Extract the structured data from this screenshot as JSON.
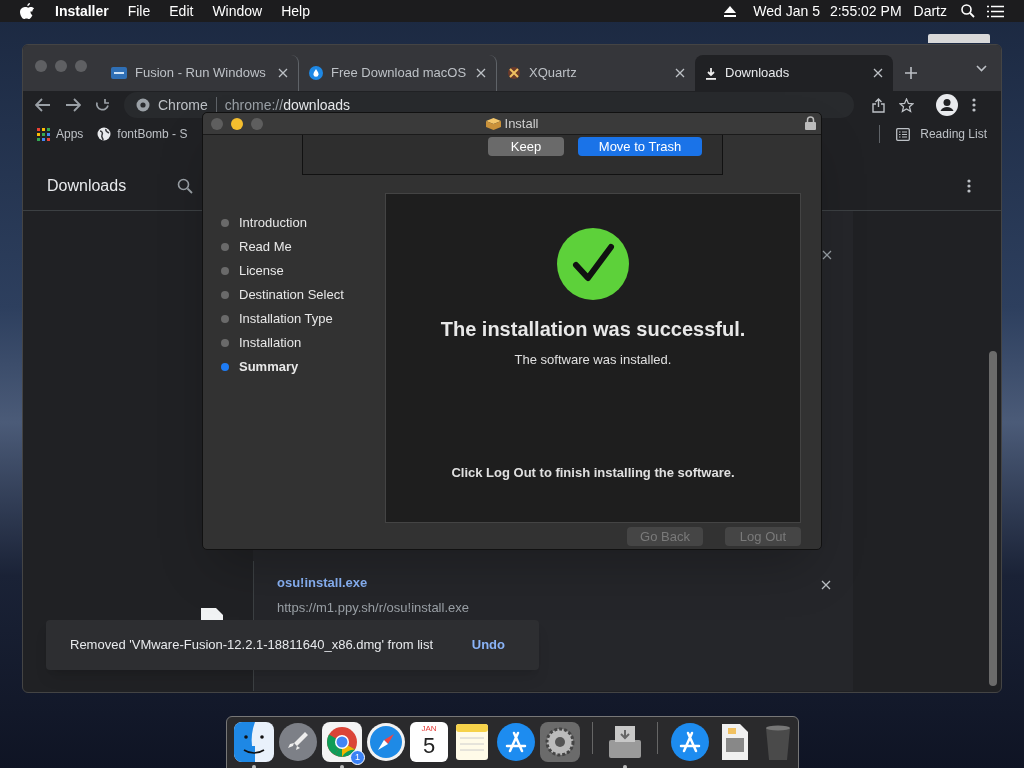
{
  "menu_bar": {
    "app": "Installer",
    "menus": [
      "File",
      "Edit",
      "Window",
      "Help"
    ],
    "date": "Wed Jan 5",
    "time": "2:55:02 PM",
    "user": "Dartz"
  },
  "browser": {
    "tabs": [
      {
        "title": "Fusion - Run Windows",
        "kind": "vmware",
        "selected": false
      },
      {
        "title": "Free Download macOS",
        "kind": "drop",
        "selected": false
      },
      {
        "title": "XQuartz",
        "kind": "x",
        "selected": false
      },
      {
        "title": "Downloads",
        "kind": "download",
        "selected": true
      }
    ],
    "omnibox": {
      "site": "Chrome",
      "url_scheme": "chrome://",
      "url_path": "downloads"
    },
    "bookmarks": [
      {
        "label": "Apps",
        "kind": "apps"
      },
      {
        "label": "fontBomb - S",
        "kind": "globe"
      }
    ],
    "reading_list": "Reading List",
    "page_title": "Downloads",
    "downloads": [
      {
        "name": "osu!install.exe",
        "url": "https://m1.ppy.sh/r/osu!install.exe"
      }
    ],
    "toast": {
      "message": "Removed 'VMware-Fusion-12.2.1-18811640_x86.dmg' from list",
      "action": "Undo"
    }
  },
  "installer": {
    "title": "Install",
    "sheet_buttons": [
      {
        "label": "Keep",
        "kind": "secondary"
      },
      {
        "label": "Move to Trash",
        "kind": "primary"
      }
    ],
    "steps": [
      {
        "label": "Introduction",
        "selected": false
      },
      {
        "label": "Read Me",
        "selected": false
      },
      {
        "label": "License",
        "selected": false
      },
      {
        "label": "Destination Select",
        "selected": false
      },
      {
        "label": "Installation Type",
        "selected": false
      },
      {
        "label": "Installation",
        "selected": false
      },
      {
        "label": "Summary",
        "selected": true
      }
    ],
    "headline": "The installation was successful.",
    "message": "The software was installed.",
    "instruction": "Click Log Out to finish installing the software.",
    "buttons": [
      {
        "label": "Go Back",
        "disabled": true
      },
      {
        "label": "Log Out",
        "disabled": true
      }
    ]
  },
  "dock": {
    "calendar_month": "JAN",
    "calendar_day": "5",
    "chrome_badge": "1",
    "apps": [
      {
        "kind": "finder",
        "running": true
      },
      {
        "kind": "launchpad",
        "running": false
      },
      {
        "kind": "chrome",
        "running": true
      },
      {
        "kind": "safari",
        "running": false
      },
      {
        "kind": "calendar",
        "running": false
      },
      {
        "kind": "notes",
        "running": false
      },
      {
        "kind": "appstore",
        "running": false
      },
      {
        "kind": "settings",
        "running": false
      },
      {
        "kind": "separator"
      },
      {
        "kind": "installer",
        "running": true
      },
      {
        "kind": "separator"
      },
      {
        "kind": "appstore",
        "running": false
      },
      {
        "kind": "document",
        "running": false
      },
      {
        "kind": "trash",
        "running": false
      }
    ]
  }
}
